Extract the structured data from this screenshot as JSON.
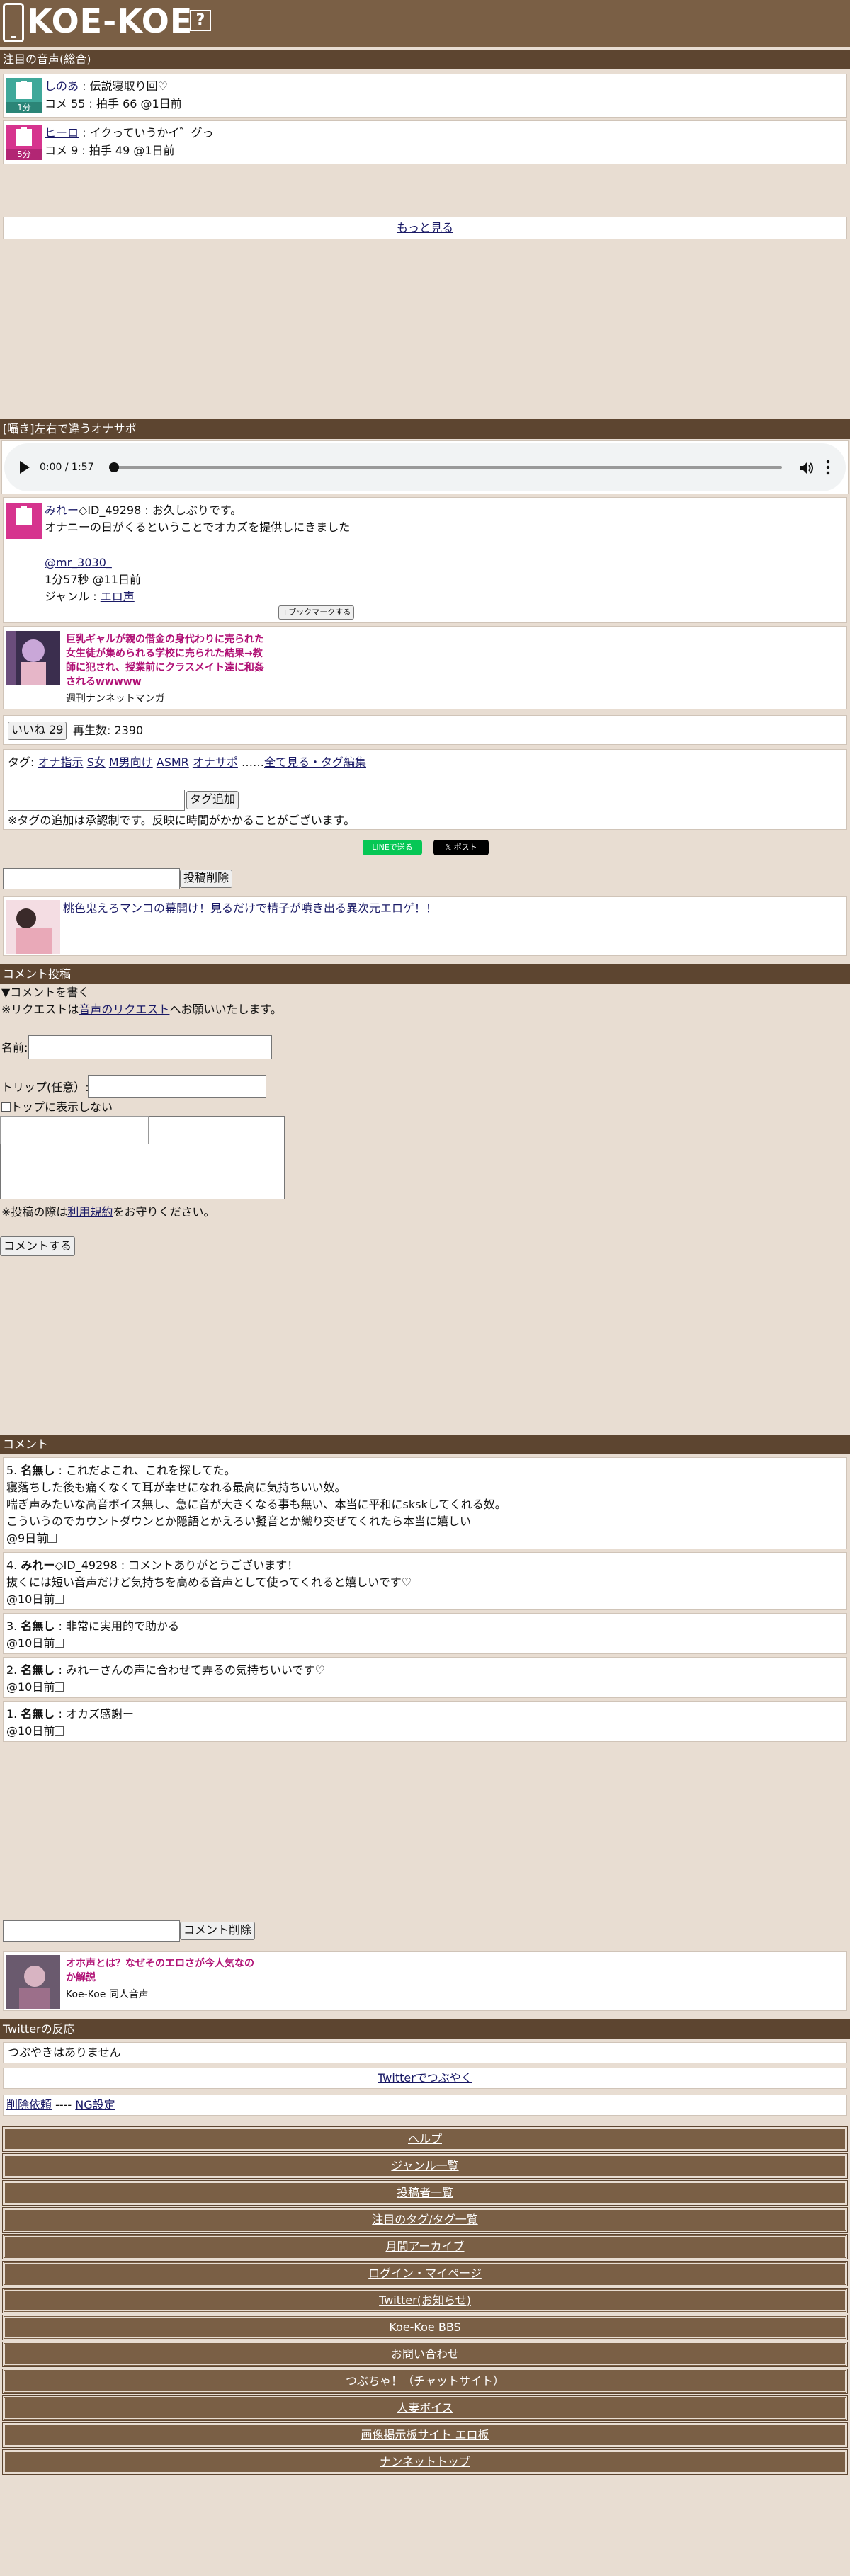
{
  "header": {
    "logo": "KOE-KOE",
    "help": "?"
  },
  "featured": {
    "title": "注目の音声(総合)",
    "items": [
      {
        "user": "しのあ",
        "text": "伝説寝取り回♡",
        "meta": "コメ 55 : 拍手 66 @1日前",
        "badge": "1分",
        "color": "#3fa89a"
      },
      {
        "user": "ヒーロ",
        "text": "イクっていうかイ゛グっ",
        "meta": "コメ 9 : 拍手 49 @1日前",
        "badge": "5分",
        "color": "#d6348e"
      }
    ],
    "more": "もっと見る"
  },
  "post": {
    "title": "[囁き]左右で違うオナサポ",
    "audio": {
      "time": "0:00 / 1:57"
    },
    "user": "みれー",
    "user_suffix": "◇ID_49298 : お久しぶりです。",
    "body": "オナニーの日がくるということでオカズを提供しにきました",
    "twitter": "@mr_3030_",
    "duration": "1分57秒 @11日前",
    "genre_label": "ジャンル : ",
    "genre": "エロ声",
    "bookmark": "+ブックマークする",
    "ad": {
      "title": "巨乳ギャルが親の借金の身代わりに売られた女生徒が集められる学校に売られた結果→教師に犯され、授業前にクラスメイト達に和姦されるwwwww",
      "source": "週刊ナンネットマンガ"
    },
    "like_button": "いいね 29",
    "plays": "再生数: 2390",
    "tags_label": "タグ: ",
    "tags": [
      "オナ指示",
      "S女",
      "M男向け",
      "ASMR",
      "オナサポ"
    ],
    "tags_sep": "……",
    "tags_edit": "全て見る・タグ編集",
    "tag_add": "タグ追加",
    "tag_note": "※タグの追加は承認制です。反映に時間がかかることがございます。",
    "line_share": "LINEで送る",
    "x_post": "ポスト",
    "delete_post": "投稿削除",
    "ad2": {
      "title": "桃色鬼えろマンコの幕開け！見るだけで精子が噴き出る異次元エロゲ！！"
    }
  },
  "comment_form": {
    "title": "コメント投稿",
    "toggle": "▼コメントを書く",
    "request_pre": "※リクエストは",
    "request_link": "音声のリクエスト",
    "request_post": "へお願いいたします。",
    "name_label": "名前:",
    "trip_label": "トリップ(任意）:",
    "hide_top": "トップに表示しない",
    "rules_pre": "※投稿の際は",
    "rules_link": "利用規約",
    "rules_post": "をお守りください。",
    "submit": "コメントする"
  },
  "comments": {
    "title": "コメント",
    "items": [
      {
        "no": "5.",
        "name": "名無し",
        "id": "",
        "lines": [
          "これだよこれ、これを探してた。",
          "寝落ちした後も痛くなくて耳が幸せになれる最高に気持ちいい奴。",
          "喘ぎ声みたいな高音ボイス無し、急に音が大きくなる事も無い、本当に平和にskskしてくれる奴。",
          "こういうのでカウントダウンとか隠語とかえろい擬音とか織り交ぜてくれたら本当に嬉しい"
        ],
        "time": "@9日前"
      },
      {
        "no": "4.",
        "name": "みれー",
        "id": "◇ID_49298",
        "lines": [
          "コメントありがとうございます！",
          "抜くには短い音声だけど気持ちを高める音声として使ってくれると嬉しいです♡"
        ],
        "time": "@10日前"
      },
      {
        "no": "3.",
        "name": "名無し",
        "id": "",
        "lines": [
          "非常に実用的で助かる"
        ],
        "time": "@10日前"
      },
      {
        "no": "2.",
        "name": "名無し",
        "id": "",
        "lines": [
          "みれーさんの声に合わせて弄るの気持ちいいです♡"
        ],
        "time": "@10日前"
      },
      {
        "no": "1.",
        "name": "名無し",
        "id": "",
        "lines": [
          "オカズ感謝ー"
        ],
        "time": "@10日前"
      }
    ],
    "delete_comment": "コメント削除"
  },
  "ad3": {
    "title": "オホ声とは？なぜそのエロさが今人気なのか解説",
    "source": "Koe-Koe 同人音声"
  },
  "twitter": {
    "title": "Twitterの反応",
    "empty": "つぶやきはありません",
    "tweet": "Twitterでつぶやく"
  },
  "footer_links": {
    "delete": "削除依頼",
    "sep": " ---- ",
    "ng": "NG設定"
  },
  "nav": [
    "ヘルプ",
    "ジャンル一覧",
    "投稿者一覧",
    "注目のタグ/タグ一覧",
    "月間アーカイブ",
    "ログイン・マイページ",
    "Twitter(お知らせ)",
    "Koe-Koe BBS",
    "お問い合わせ",
    "つぶちゃ！（チャットサイト）",
    "人妻ボイス",
    "画像掲示板サイト エロ板",
    "ナンネットトップ"
  ],
  "colors": {
    "brown": "#7a5f45",
    "dark_brown": "#5d4530",
    "bg": "#e8ddd2",
    "promo": "#b01075"
  }
}
